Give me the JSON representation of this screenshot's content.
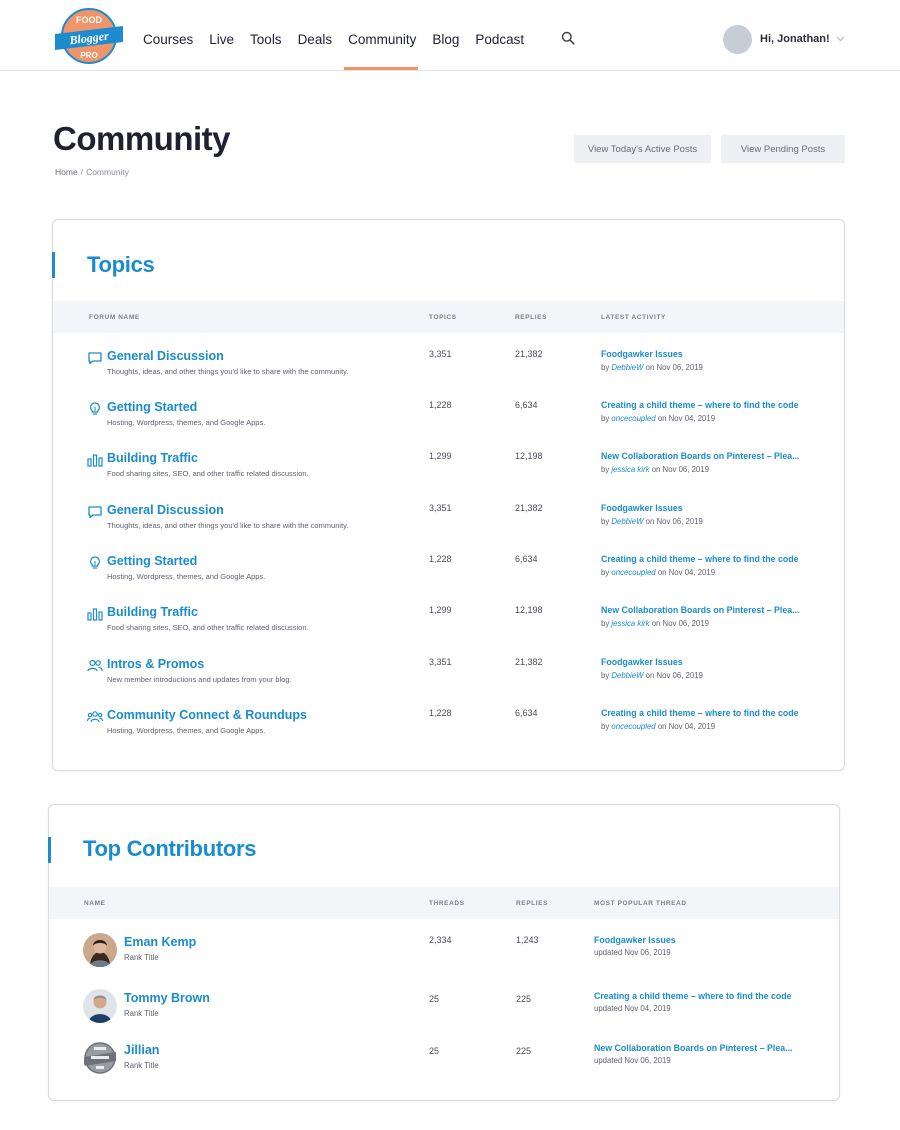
{
  "brand": {
    "logo_lines": [
      "FOOD",
      "Blogger",
      "PRO"
    ],
    "accent_color": "#1a8ccd",
    "logo_orange": "#f0956a",
    "logo_blue": "#1d8bd0"
  },
  "nav": {
    "items": [
      {
        "label": "Courses"
      },
      {
        "label": "Live"
      },
      {
        "label": "Tools"
      },
      {
        "label": "Deals"
      },
      {
        "label": "Community",
        "active": true
      },
      {
        "label": "Blog"
      },
      {
        "label": "Podcast"
      }
    ],
    "search_icon": "search-icon",
    "greeting": "Hi, Jonathan!"
  },
  "page": {
    "title": "Community",
    "breadcrumb": {
      "home": "Home",
      "separator": "/",
      "current": "Community"
    },
    "buttons": {
      "active_posts": "View Today's Active Posts",
      "pending_posts": "View Pending Posts"
    }
  },
  "topics": {
    "title": "Topics",
    "columns": {
      "forum": "FORUM NAME",
      "topics": "TOPICS",
      "replies": "REPLIES",
      "latest": "LATEST ACTIVITY"
    },
    "rows": [
      {
        "icon": "chat-bubble-icon",
        "name": "General Discussion",
        "desc": "Thoughts, ideas, and other things you'd like to share with the community.",
        "topics": "3,351",
        "replies": "21,382",
        "latest_title": "Foodgawker Issues",
        "by": "by",
        "user": "DebbieW",
        "date": "on Nov 06, 2019"
      },
      {
        "icon": "lightbulb-icon",
        "name": "Getting Started",
        "desc": "Hosting, Wordpress, themes, and Google Apps.",
        "topics": "1,228",
        "replies": "6,634",
        "latest_title": "Creating a child theme – where to find the code",
        "by": "by",
        "user": "oncecoupled",
        "date": "on Nov 04, 2019"
      },
      {
        "icon": "bar-chart-icon",
        "name": "Building Traffic",
        "desc": "Food sharing sites, SEO, and other traffic related discussion.",
        "topics": "1,299",
        "replies": "12,198",
        "latest_title": "New Collaboration Boards on Pinterest – Plea...",
        "by": "by",
        "user": "jessica kirk",
        "date": "on Nov 06, 2019"
      },
      {
        "icon": "chat-bubble-icon",
        "name": "General Discussion",
        "desc": "Thoughts, ideas, and other things you'd like to share with the community.",
        "topics": "3,351",
        "replies": "21,382",
        "latest_title": "Foodgawker Issues",
        "by": "by",
        "user": "DebbieW",
        "date": "on Nov 06, 2019"
      },
      {
        "icon": "lightbulb-icon",
        "name": "Getting Started",
        "desc": "Hosting, Wordpress, themes, and Google Apps.",
        "topics": "1,228",
        "replies": "6,634",
        "latest_title": "Creating a child theme – where to find the code",
        "by": "by",
        "user": "oncecoupled",
        "date": "on Nov 04, 2019"
      },
      {
        "icon": "bar-chart-icon",
        "name": "Building Traffic",
        "desc": "Food sharing sites, SEO, and other traffic related discussion.",
        "topics": "1,299",
        "replies": "12,198",
        "latest_title": "New Collaboration Boards on Pinterest – Plea...",
        "by": "by",
        "user": "jessica kirk",
        "date": "on Nov 06, 2019"
      },
      {
        "icon": "two-people-icon",
        "name": "Intros & Promos",
        "desc": "New member introductions and updates from your blog.",
        "topics": "3,351",
        "replies": "21,382",
        "latest_title": "Foodgawker Issues",
        "by": "by",
        "user": "DebbieW",
        "date": "on Nov 06, 2019"
      },
      {
        "icon": "group-icon",
        "name": "Community Connect & Roundups",
        "desc": "Hosting, Wordpress, themes, and Google Apps.",
        "topics": "1,228",
        "replies": "6,634",
        "latest_title": "Creating a child theme – where to find the code",
        "by": "by",
        "user": "oncecoupled",
        "date": "on Nov 04, 2019"
      }
    ]
  },
  "contributors": {
    "title": "Top Contributors",
    "columns": {
      "name": "NAME",
      "threads": "THREADS",
      "replies": "REPLIES",
      "popular": "MOST POPULAR THREAD"
    },
    "rows": [
      {
        "avatar": "photo-avatar-woman",
        "name": "Eman Kemp",
        "rank": "Rank Title",
        "threads": "2,334",
        "replies": "1,243",
        "thread": "Foodgawker Issues",
        "updated": "updated Nov 06, 2019"
      },
      {
        "avatar": "photo-avatar-man",
        "name": "Tommy Brown",
        "rank": "Rank Title",
        "threads": "25",
        "replies": "225",
        "thread": "Creating a child theme – where to find the code",
        "updated": "updated Nov 04, 2019"
      },
      {
        "avatar": "logo-avatar",
        "name": "Jillian",
        "rank": "Rank Title",
        "threads": "25",
        "replies": "225",
        "thread": "New Collaboration Boards on Pinterest – Plea...",
        "updated": "updated Nov 06, 2019"
      }
    ]
  }
}
